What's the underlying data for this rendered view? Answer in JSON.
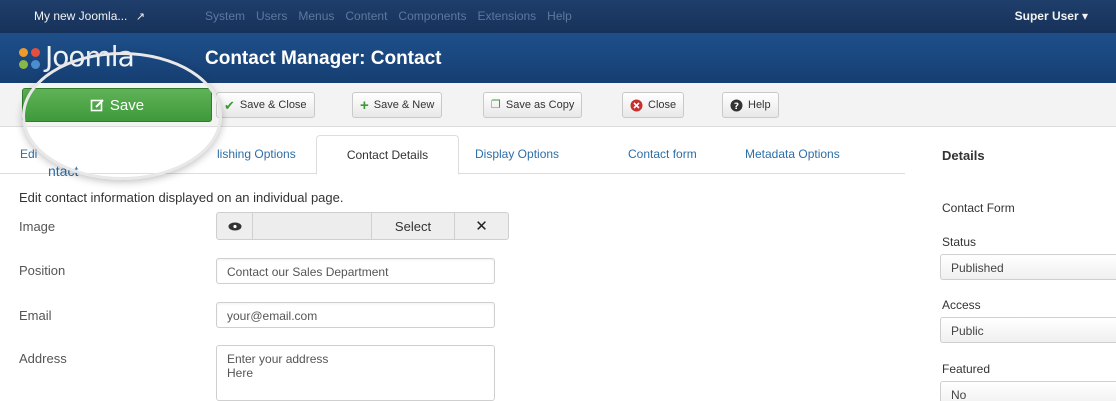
{
  "topbar": {
    "site_name": "My new Joomla...",
    "menu": [
      "System",
      "Users",
      "Menus",
      "Content",
      "Components",
      "Extensions",
      "Help"
    ],
    "user": "Super User ▾"
  },
  "header": {
    "logo_text": "Joomla",
    "title": "Contact Manager: Contact"
  },
  "toolbar": {
    "save": "Save",
    "save_close": "Save & Close",
    "save_new": "Save & New",
    "save_copy": "Save as Copy",
    "close": "Close",
    "help": "Help"
  },
  "tabs": {
    "edit_contact_a": "Edi",
    "edit_contact_b": "ntact",
    "publishing": "lishing Options",
    "contact_details": "Contact Details",
    "display": "Display Options",
    "contact_form": "Contact form",
    "metadata": "Metadata Options"
  },
  "form": {
    "description": "Edit contact information displayed on an individual page.",
    "image_label": "Image",
    "select_label": "Select",
    "position_label": "Position",
    "position_value": "Contact our Sales Department",
    "email_label": "Email",
    "email_value": "your@email.com",
    "address_label": "Address",
    "address_value": "Enter your address\nHere"
  },
  "sidebar": {
    "title": "Details",
    "contact_form_label": "Contact Form",
    "status_label": "Status",
    "status_value": "Published",
    "access_label": "Access",
    "access_value": "Public",
    "featured_label": "Featured",
    "featured_value": "No"
  },
  "colors": {
    "navbar": "#1f3e6b",
    "header": "#1e4f8a",
    "save_green": "#4ea847",
    "link_blue": "#2c6ea8"
  }
}
